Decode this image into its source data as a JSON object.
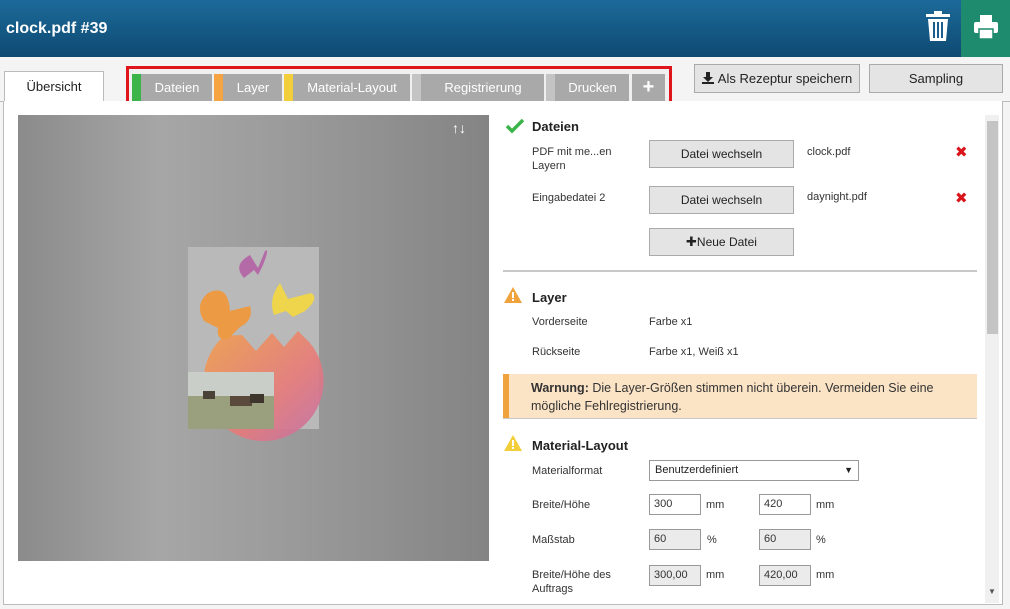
{
  "header": {
    "title": "clock.pdf #39"
  },
  "tabs": {
    "overview": "Übersicht"
  },
  "steps": [
    {
      "label": "Dateien",
      "color": "#3bb54a"
    },
    {
      "label": "Layer",
      "color": "#f5a441"
    },
    {
      "label": "Material-Layout",
      "color": "#f2cf3a"
    },
    {
      "label": "Registrierung",
      "color": "#a9a9a9"
    },
    {
      "label": "Drucken",
      "color": "#a9a9a9"
    }
  ],
  "add_step": "+",
  "toolbar": {
    "save_recipe": "Als Rezeptur speichern",
    "sampling": "Sampling"
  },
  "preview": {
    "arrows": "↑↓"
  },
  "files": {
    "title": "Dateien",
    "rows": [
      {
        "label": "PDF mit me...en Layern",
        "button": "Datei wechseln",
        "file": "clock.pdf"
      },
      {
        "label": "Eingabedatei 2",
        "button": "Datei wechseln",
        "file": "daynight.pdf"
      }
    ],
    "new_file": "Neue Datei"
  },
  "layer": {
    "title": "Layer",
    "rows": [
      {
        "label": "Vorderseite",
        "value": "Farbe x1"
      },
      {
        "label": "Rückseite",
        "value": "Farbe x1, Weiß x1"
      }
    ],
    "warning_bold": "Warnung:",
    "warning_text": " Die Layer-Größen stimmen nicht überein. Vermeiden Sie eine mögliche Fehlregistrierung."
  },
  "material": {
    "title": "Material-Layout",
    "format_label": "Materialformat",
    "format_value": "Benutzerdefiniert",
    "size_label": "Breite/Höhe",
    "width": "300",
    "height": "420",
    "unit_mm": "mm",
    "scale_label": "Maßstab",
    "scale_x": "60",
    "scale_y": "60",
    "unit_pct": "%",
    "job_label": "Breite/Höhe des Auftrags",
    "job_width": "300,00",
    "job_height": "420,00"
  },
  "colors": {
    "header": "#0e4a72",
    "print": "#1e8a6e",
    "highlight": "#e0151b",
    "warning_bg": "#fbe3c6",
    "warning_border": "#f0a33c"
  }
}
